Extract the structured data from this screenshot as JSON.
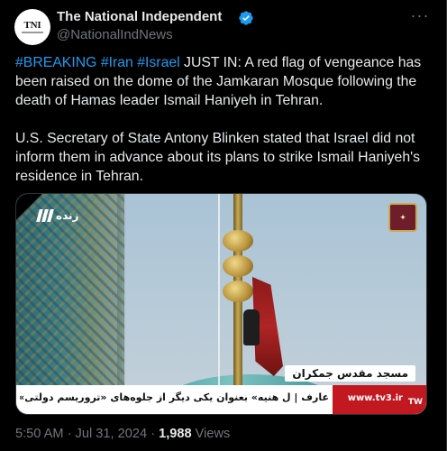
{
  "author": {
    "display_name": "The National Independent",
    "handle": "@NationalIndNews",
    "avatar_text": "TNI",
    "verified": true
  },
  "tweet": {
    "hashtags": [
      "#BREAKING",
      "#Iran",
      "#Israel"
    ],
    "paragraph1_text": "JUST IN: A red flag of vengeance has been raised on the dome of the Jamkaran Mosque following the death of Hamas leader Ismail Haniyeh in Tehran.",
    "paragraph2_text": "U.S. Secretary of State Antony Blinken stated that Israel did not inform them in advance about its plans to strike Ismail Haniyeh's residence in Tehran."
  },
  "media": {
    "live_label": "زنده",
    "location_caption": "مسجد مقدس جمکران",
    "ticker_text": "عارف | ل هنیه» بعنوان یکی دیگر از جلوه‌های «تروریسم دولتی» است",
    "channel_url": "www.tv3.ir",
    "ticker_badge": "TW"
  },
  "footer": {
    "time": "5:50 AM",
    "separator": "·",
    "date": "Jul 31, 2024",
    "views_count": "1,988",
    "views_label": "Views"
  },
  "colors": {
    "background": "#000000",
    "text": "#e7e9ea",
    "secondary": "#71767b",
    "accent": "#1d9bf0"
  },
  "icons": {
    "verified": "verified-badge-icon",
    "more": "more-options-icon"
  }
}
